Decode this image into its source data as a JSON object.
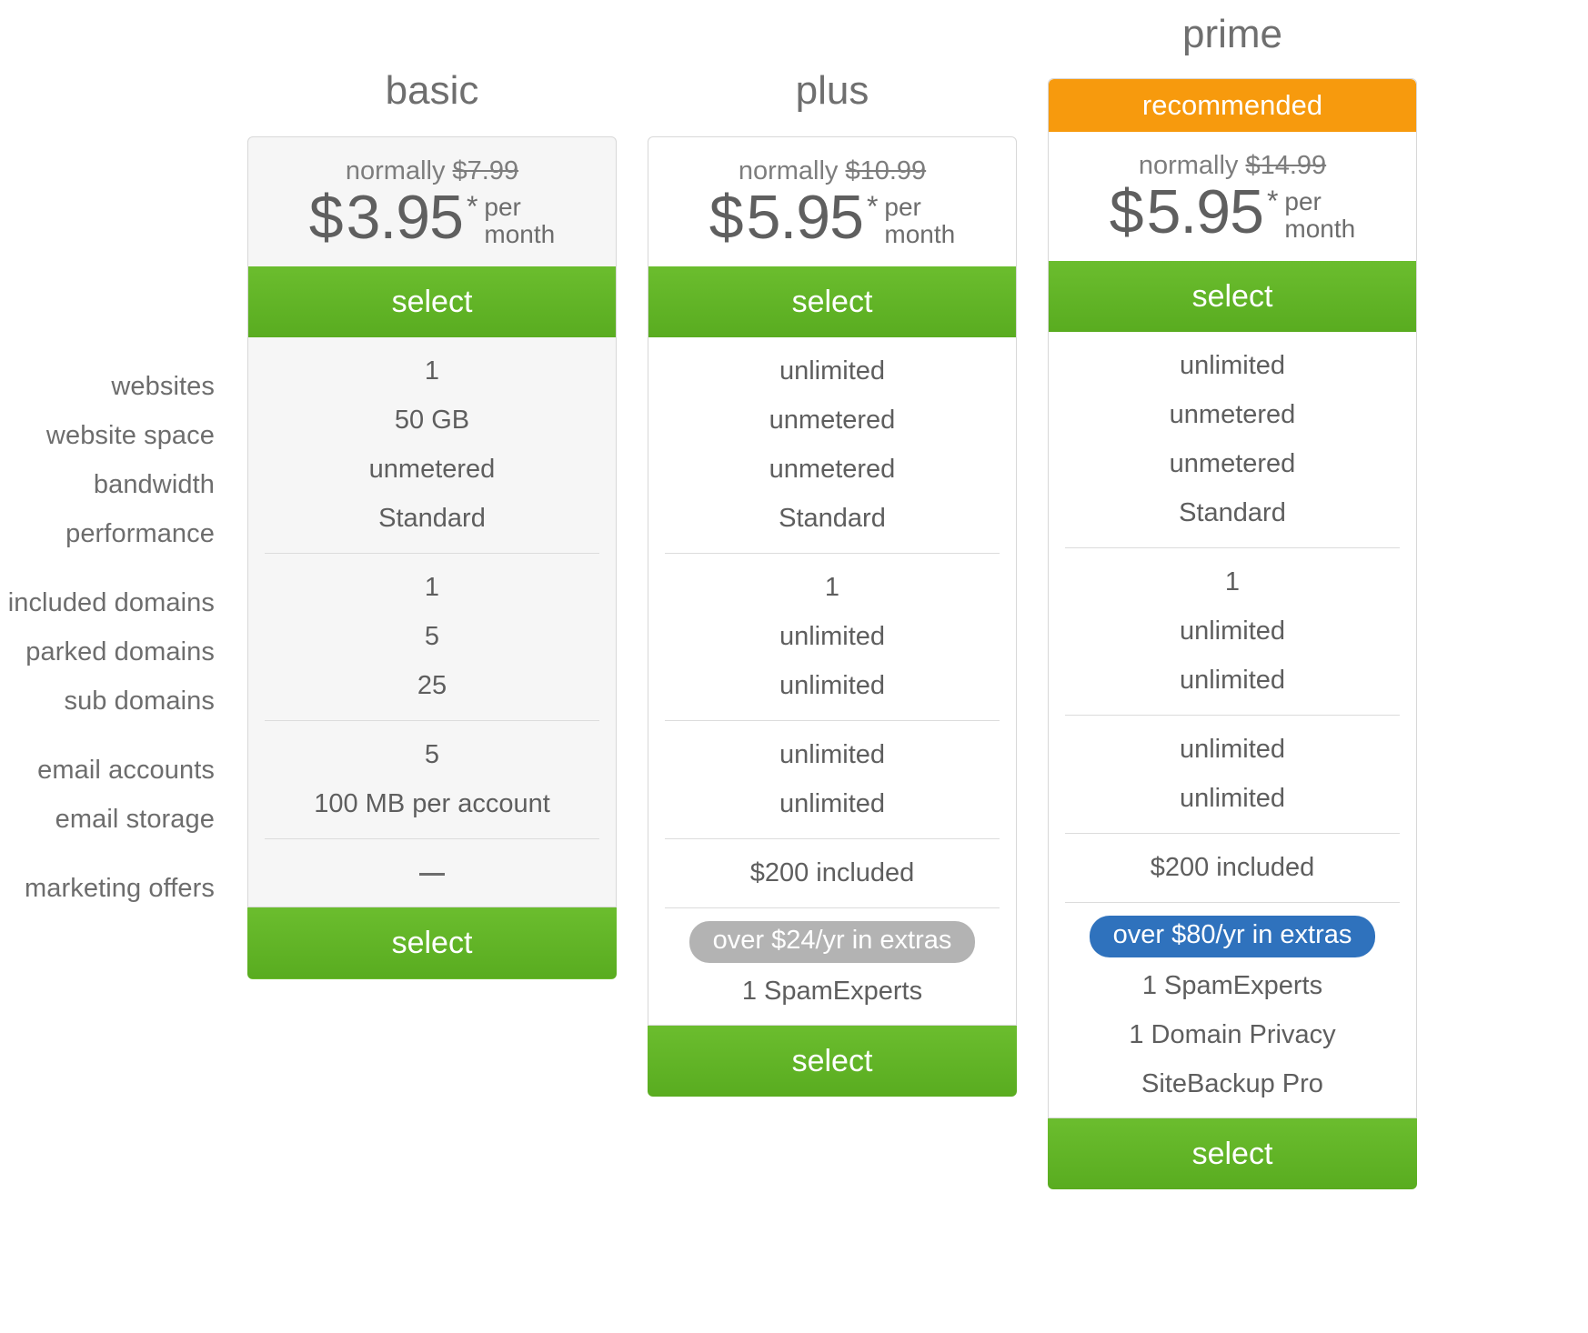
{
  "feature_labels": [
    "websites",
    "website space",
    "bandwidth",
    "performance",
    "included domains",
    "parked domains",
    "sub domains",
    "email accounts",
    "email storage",
    "marketing offers"
  ],
  "labels": {
    "websites": "websites",
    "website_space": "website space",
    "bandwidth": "bandwidth",
    "performance": "performance",
    "included_domains": "included domains",
    "parked_domains": "parked domains",
    "sub_domains": "sub domains",
    "email_accounts": "email accounts",
    "email_storage": "email storage",
    "marketing_offers": "marketing offers"
  },
  "colors": {
    "select_green": "#62b82a",
    "recommended_orange": "#f79a0d",
    "pill_grey": "#b3b3b3",
    "pill_blue": "#2f72bd",
    "card_border": "#d8d8d8",
    "text_grey": "#5e5e5e"
  },
  "plans": {
    "basic": {
      "title": "basic",
      "normally_prefix": "normally",
      "normally_price": "$7.99",
      "currency": "$",
      "price": "3.95",
      "star": "*",
      "per_line1": "per",
      "per_line2": "month",
      "select_top": "select",
      "select_bottom": "select",
      "values": {
        "websites": "1",
        "website_space": "50 GB",
        "bandwidth": "unmetered",
        "performance": "Standard",
        "included_domains": "1",
        "parked_domains": "5",
        "sub_domains": "25",
        "email_accounts": "5",
        "email_storage": "100 MB per account",
        "marketing_offers": "—"
      },
      "extras_pill": null,
      "extras": []
    },
    "plus": {
      "title": "plus",
      "normally_prefix": "normally",
      "normally_price": "$10.99",
      "currency": "$",
      "price": "5.95",
      "star": "*",
      "per_line1": "per",
      "per_line2": "month",
      "select_top": "select",
      "select_bottom": "select",
      "values": {
        "websites": "unlimited",
        "website_space": "unmetered",
        "bandwidth": "unmetered",
        "performance": "Standard",
        "included_domains": "1",
        "parked_domains": "unlimited",
        "sub_domains": "unlimited",
        "email_accounts": "unlimited",
        "email_storage": "unlimited",
        "marketing_offers": "$200 included"
      },
      "extras_pill": "over $24/yr in extras",
      "extras": [
        "1 SpamExperts"
      ]
    },
    "prime": {
      "title": "prime",
      "ribbon": "recommended",
      "normally_prefix": "normally",
      "normally_price": "$14.99",
      "currency": "$",
      "price": "5.95",
      "star": "*",
      "per_line1": "per",
      "per_line2": "month",
      "select_top": "select",
      "select_bottom": "select",
      "values": {
        "websites": "unlimited",
        "website_space": "unmetered",
        "bandwidth": "unmetered",
        "performance": "Standard",
        "included_domains": "1",
        "parked_domains": "unlimited",
        "sub_domains": "unlimited",
        "email_accounts": "unlimited",
        "email_storage": "unlimited",
        "marketing_offers": "$200 included"
      },
      "extras_pill": "over $80/yr in extras",
      "extras": [
        "1 SpamExperts",
        "1 Domain Privacy",
        "SiteBackup Pro"
      ]
    }
  }
}
